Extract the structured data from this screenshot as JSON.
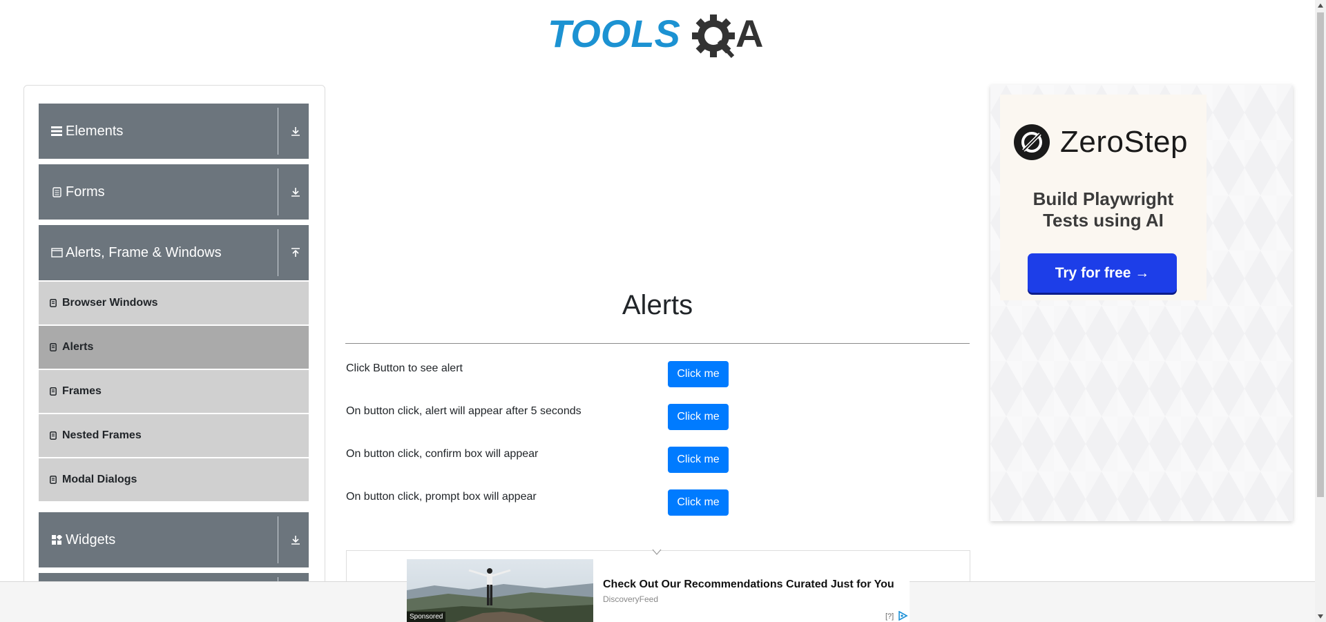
{
  "logo": {
    "text_left": "TOOLS",
    "text_right": "A",
    "brand_blue": "#1c92d2",
    "brand_dark": "#333333"
  },
  "sidebar": {
    "groups": [
      {
        "label": "Elements",
        "icon": "list-icon",
        "arrow": "expand-down-icon"
      },
      {
        "label": "Forms",
        "icon": "form-icon",
        "arrow": "expand-down-icon"
      },
      {
        "label": "Alerts, Frame & Windows",
        "icon": "window-icon",
        "arrow": "collapse-up-icon"
      },
      {
        "label": "Widgets",
        "icon": "widgets-icon",
        "arrow": "expand-down-icon"
      }
    ],
    "items": [
      {
        "label": "Browser Windows",
        "active": false
      },
      {
        "label": "Alerts",
        "active": true
      },
      {
        "label": "Frames",
        "active": false
      },
      {
        "label": "Nested Frames",
        "active": false
      },
      {
        "label": "Modal Dialogs",
        "active": false
      }
    ]
  },
  "main": {
    "title": "Alerts",
    "rows": [
      {
        "label": "Click Button to see alert",
        "button": "Click me"
      },
      {
        "label": "On button click, alert will appear after 5 seconds",
        "button": "Click me"
      },
      {
        "label": "On button click, confirm box will appear",
        "button": "Click me"
      },
      {
        "label": "On button click, prompt box will appear",
        "button": "Click me"
      }
    ]
  },
  "right_ad": {
    "brand": "ZeroStep",
    "tagline_line1": "Build Playwright",
    "tagline_line2": "Tests using AI",
    "cta": "Try for free →",
    "cta_color": "#1d3ee8"
  },
  "bottom_ad": {
    "sponsored": "Sponsored",
    "headline": "Check Out Our Recommendations Curated Just for You",
    "source": "DiscoveryFeed",
    "help": "[?]"
  },
  "colors": {
    "group_bg": "#6c757d",
    "item_bg": "#d0d0d0",
    "item_active_bg": "#aaaaaa",
    "button_blue": "#007bff"
  }
}
